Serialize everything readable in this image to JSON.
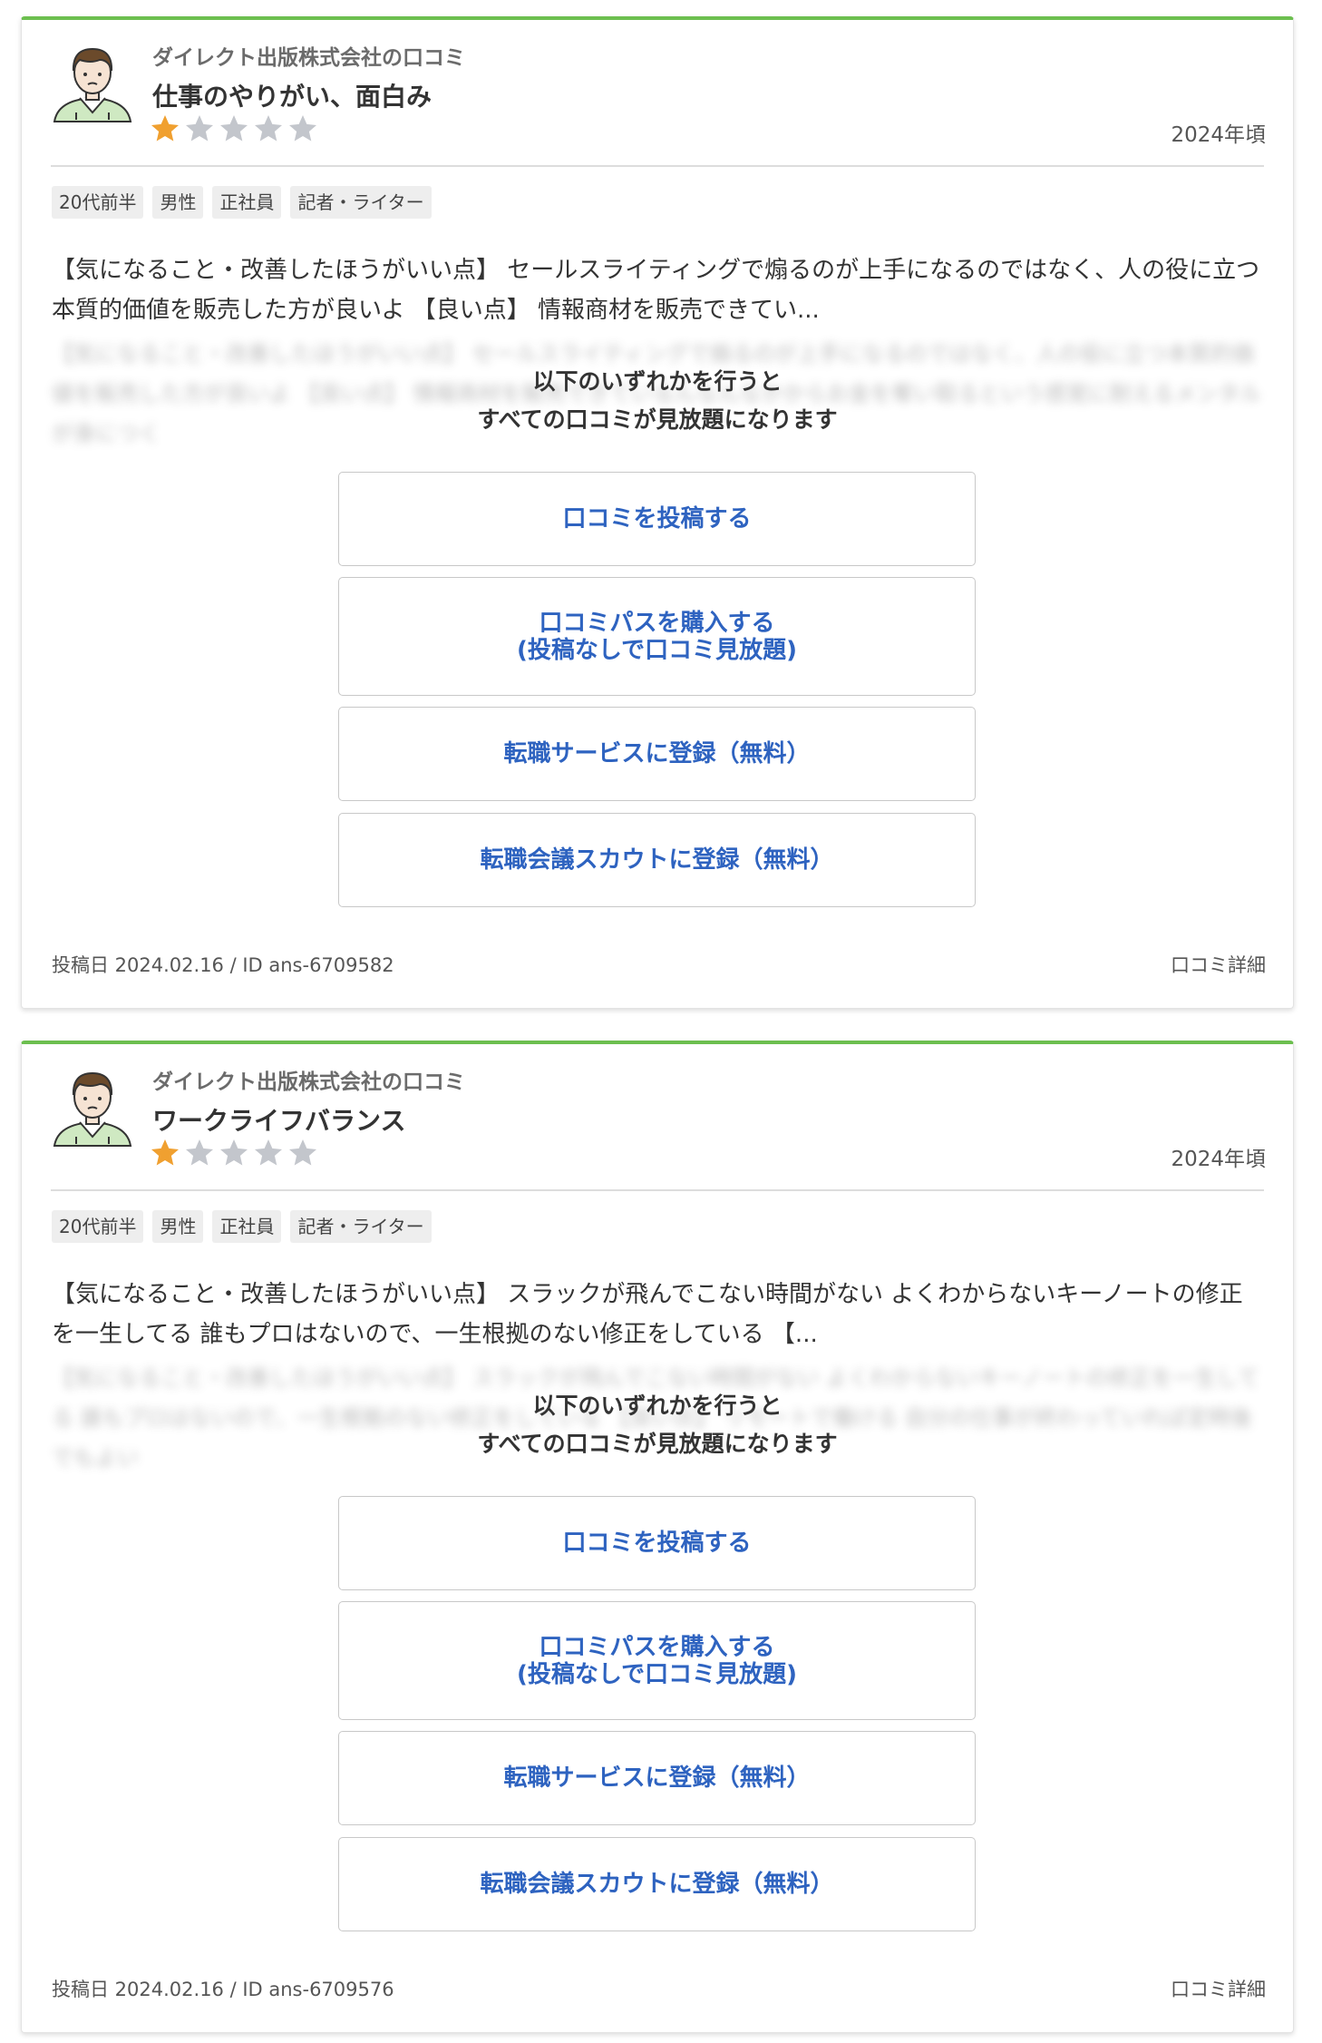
{
  "colors": {
    "accent_border": "#6cbf4f",
    "star_filled": "#f0a030",
    "star_empty": "#c3c6cc",
    "button_text": "#2e63c0"
  },
  "reviews": [
    {
      "company": "ダイレクト出版株式会社の口コミ",
      "title": "仕事のやりがい、面白み",
      "rating": 1,
      "rating_max": 5,
      "period": "2024年頃",
      "tags": [
        "20代前半",
        "男性",
        "正社員",
        "記者・ライター"
      ],
      "excerpt": "【気になること・改善したほうがいい点】 セールスライティングで煽るのが上手になるのではなく、人の役に立つ本質的価値を販売した方が良いよ 【良い点】 情報商材を販売できてい...",
      "blurred_text": "【気になること・改善したほうがいい点】 セールスライティングで煽るのが上手になるのではなく、人の役に立つ本質的価値を販売した方が良いよ 【良い点】 情報商材を販売できているんなんなかからお金を奪い取るという感覚に耐えるメンタルが身につく",
      "unlock_line1": "以下のいずれかを行うと",
      "unlock_line2": "すべての口コミが見放題になります",
      "buttons": {
        "post": "口コミを投稿する",
        "pass_line1": "口コミパスを購入する",
        "pass_line2": "(投稿なしで口コミ見放題)",
        "service": "転職サービスに登録（無料）",
        "scout": "転職会議スカウトに登録（無料）"
      },
      "posted": "投稿日 2024.02.16 / ID ans-6709582",
      "detail_link": "口コミ詳細"
    },
    {
      "company": "ダイレクト出版株式会社の口コミ",
      "title": "ワークライフバランス",
      "rating": 1,
      "rating_max": 5,
      "period": "2024年頃",
      "tags": [
        "20代前半",
        "男性",
        "正社員",
        "記者・ライター"
      ],
      "excerpt": "【気になること・改善したほうがいい点】 スラックが飛んでこない時間がない よくわからないキーノートの修正を一生してる 誰もプロはないので、一生根拠のない修正をしている 【...",
      "blurred_text": "【気になること・改善したほうがいい点】 スラックが飛んでこない時間がない よくわからないキーノートの修正を一生してる 誰もプロはないので、一生根拠のない修正をしている 【良い点】 リモートで働ける 自分の仕事が終わっていれば定時後でもよい",
      "unlock_line1": "以下のいずれかを行うと",
      "unlock_line2": "すべての口コミが見放題になります",
      "buttons": {
        "post": "口コミを投稿する",
        "pass_line1": "口コミパスを購入する",
        "pass_line2": "(投稿なしで口コミ見放題)",
        "service": "転職サービスに登録（無料）",
        "scout": "転職会議スカウトに登録（無料）"
      },
      "posted": "投稿日 2024.02.16 / ID ans-6709576",
      "detail_link": "口コミ詳細"
    }
  ]
}
